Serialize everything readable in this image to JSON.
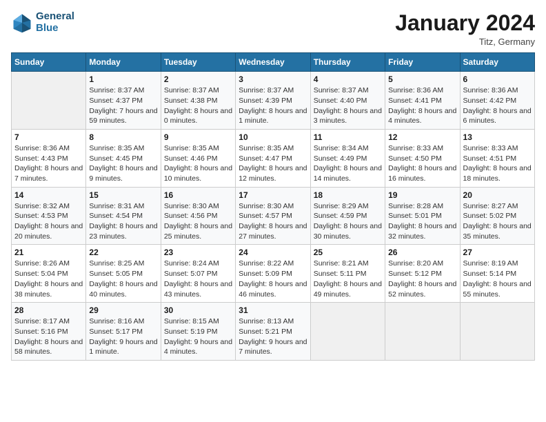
{
  "header": {
    "logo_line1": "General",
    "logo_line2": "Blue",
    "month": "January 2024",
    "location": "Titz, Germany"
  },
  "days_of_week": [
    "Sunday",
    "Monday",
    "Tuesday",
    "Wednesday",
    "Thursday",
    "Friday",
    "Saturday"
  ],
  "weeks": [
    [
      {
        "day": "",
        "sunrise": "",
        "sunset": "",
        "daylight": "",
        "empty": true
      },
      {
        "day": "1",
        "sunrise": "Sunrise: 8:37 AM",
        "sunset": "Sunset: 4:37 PM",
        "daylight": "Daylight: 7 hours and 59 minutes."
      },
      {
        "day": "2",
        "sunrise": "Sunrise: 8:37 AM",
        "sunset": "Sunset: 4:38 PM",
        "daylight": "Daylight: 8 hours and 0 minutes."
      },
      {
        "day": "3",
        "sunrise": "Sunrise: 8:37 AM",
        "sunset": "Sunset: 4:39 PM",
        "daylight": "Daylight: 8 hours and 1 minute."
      },
      {
        "day": "4",
        "sunrise": "Sunrise: 8:37 AM",
        "sunset": "Sunset: 4:40 PM",
        "daylight": "Daylight: 8 hours and 3 minutes."
      },
      {
        "day": "5",
        "sunrise": "Sunrise: 8:36 AM",
        "sunset": "Sunset: 4:41 PM",
        "daylight": "Daylight: 8 hours and 4 minutes."
      },
      {
        "day": "6",
        "sunrise": "Sunrise: 8:36 AM",
        "sunset": "Sunset: 4:42 PM",
        "daylight": "Daylight: 8 hours and 6 minutes."
      }
    ],
    [
      {
        "day": "7",
        "sunrise": "Sunrise: 8:36 AM",
        "sunset": "Sunset: 4:43 PM",
        "daylight": "Daylight: 8 hours and 7 minutes."
      },
      {
        "day": "8",
        "sunrise": "Sunrise: 8:35 AM",
        "sunset": "Sunset: 4:45 PM",
        "daylight": "Daylight: 8 hours and 9 minutes."
      },
      {
        "day": "9",
        "sunrise": "Sunrise: 8:35 AM",
        "sunset": "Sunset: 4:46 PM",
        "daylight": "Daylight: 8 hours and 10 minutes."
      },
      {
        "day": "10",
        "sunrise": "Sunrise: 8:35 AM",
        "sunset": "Sunset: 4:47 PM",
        "daylight": "Daylight: 8 hours and 12 minutes."
      },
      {
        "day": "11",
        "sunrise": "Sunrise: 8:34 AM",
        "sunset": "Sunset: 4:49 PM",
        "daylight": "Daylight: 8 hours and 14 minutes."
      },
      {
        "day": "12",
        "sunrise": "Sunrise: 8:33 AM",
        "sunset": "Sunset: 4:50 PM",
        "daylight": "Daylight: 8 hours and 16 minutes."
      },
      {
        "day": "13",
        "sunrise": "Sunrise: 8:33 AM",
        "sunset": "Sunset: 4:51 PM",
        "daylight": "Daylight: 8 hours and 18 minutes."
      }
    ],
    [
      {
        "day": "14",
        "sunrise": "Sunrise: 8:32 AM",
        "sunset": "Sunset: 4:53 PM",
        "daylight": "Daylight: 8 hours and 20 minutes."
      },
      {
        "day": "15",
        "sunrise": "Sunrise: 8:31 AM",
        "sunset": "Sunset: 4:54 PM",
        "daylight": "Daylight: 8 hours and 23 minutes."
      },
      {
        "day": "16",
        "sunrise": "Sunrise: 8:30 AM",
        "sunset": "Sunset: 4:56 PM",
        "daylight": "Daylight: 8 hours and 25 minutes."
      },
      {
        "day": "17",
        "sunrise": "Sunrise: 8:30 AM",
        "sunset": "Sunset: 4:57 PM",
        "daylight": "Daylight: 8 hours and 27 minutes."
      },
      {
        "day": "18",
        "sunrise": "Sunrise: 8:29 AM",
        "sunset": "Sunset: 4:59 PM",
        "daylight": "Daylight: 8 hours and 30 minutes."
      },
      {
        "day": "19",
        "sunrise": "Sunrise: 8:28 AM",
        "sunset": "Sunset: 5:01 PM",
        "daylight": "Daylight: 8 hours and 32 minutes."
      },
      {
        "day": "20",
        "sunrise": "Sunrise: 8:27 AM",
        "sunset": "Sunset: 5:02 PM",
        "daylight": "Daylight: 8 hours and 35 minutes."
      }
    ],
    [
      {
        "day": "21",
        "sunrise": "Sunrise: 8:26 AM",
        "sunset": "Sunset: 5:04 PM",
        "daylight": "Daylight: 8 hours and 38 minutes."
      },
      {
        "day": "22",
        "sunrise": "Sunrise: 8:25 AM",
        "sunset": "Sunset: 5:05 PM",
        "daylight": "Daylight: 8 hours and 40 minutes."
      },
      {
        "day": "23",
        "sunrise": "Sunrise: 8:24 AM",
        "sunset": "Sunset: 5:07 PM",
        "daylight": "Daylight: 8 hours and 43 minutes."
      },
      {
        "day": "24",
        "sunrise": "Sunrise: 8:22 AM",
        "sunset": "Sunset: 5:09 PM",
        "daylight": "Daylight: 8 hours and 46 minutes."
      },
      {
        "day": "25",
        "sunrise": "Sunrise: 8:21 AM",
        "sunset": "Sunset: 5:11 PM",
        "daylight": "Daylight: 8 hours and 49 minutes."
      },
      {
        "day": "26",
        "sunrise": "Sunrise: 8:20 AM",
        "sunset": "Sunset: 5:12 PM",
        "daylight": "Daylight: 8 hours and 52 minutes."
      },
      {
        "day": "27",
        "sunrise": "Sunrise: 8:19 AM",
        "sunset": "Sunset: 5:14 PM",
        "daylight": "Daylight: 8 hours and 55 minutes."
      }
    ],
    [
      {
        "day": "28",
        "sunrise": "Sunrise: 8:17 AM",
        "sunset": "Sunset: 5:16 PM",
        "daylight": "Daylight: 8 hours and 58 minutes."
      },
      {
        "day": "29",
        "sunrise": "Sunrise: 8:16 AM",
        "sunset": "Sunset: 5:17 PM",
        "daylight": "Daylight: 9 hours and 1 minute."
      },
      {
        "day": "30",
        "sunrise": "Sunrise: 8:15 AM",
        "sunset": "Sunset: 5:19 PM",
        "daylight": "Daylight: 9 hours and 4 minutes."
      },
      {
        "day": "31",
        "sunrise": "Sunrise: 8:13 AM",
        "sunset": "Sunset: 5:21 PM",
        "daylight": "Daylight: 9 hours and 7 minutes."
      },
      {
        "day": "",
        "sunrise": "",
        "sunset": "",
        "daylight": "",
        "empty": true
      },
      {
        "day": "",
        "sunrise": "",
        "sunset": "",
        "daylight": "",
        "empty": true
      },
      {
        "day": "",
        "sunrise": "",
        "sunset": "",
        "daylight": "",
        "empty": true
      }
    ]
  ]
}
